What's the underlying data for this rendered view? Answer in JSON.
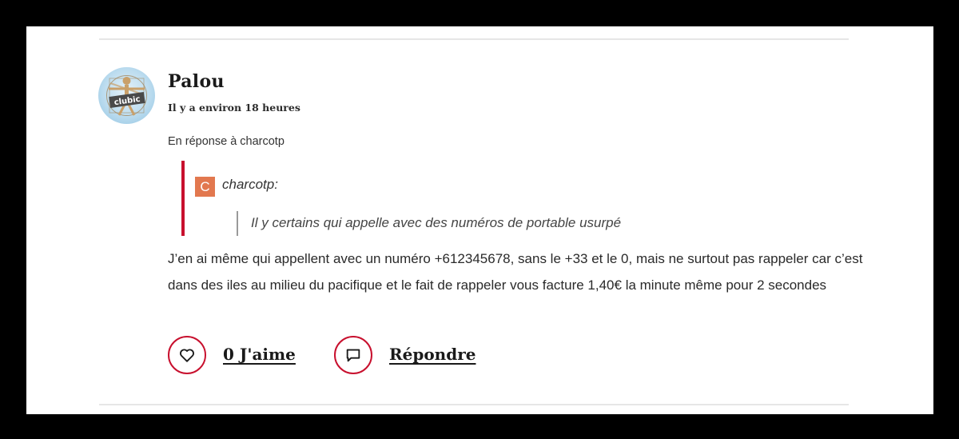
{
  "comment": {
    "author": "Palou",
    "avatar_label": "clubic",
    "timestamp": "Il y a environ 18 heures",
    "in_reply_to": "En réponse à charcotp",
    "quote": {
      "avatar_letter": "C",
      "author": "charcotp:",
      "text": "Il y certains qui appelle avec des numéros de portable usurpé"
    },
    "body": "J’en ai même qui appellent avec un numéro +612345678, sans le +33 et le 0, mais ne surtout pas rappeler car c’est dans des iles au milieu du pacifique et le fait de rappeler vous facture 1,40€ la minute même pour 2 secondes"
  },
  "actions": {
    "like_label": "0 J'aime",
    "reply_label": "Répondre"
  },
  "colors": {
    "accent": "#c8102e",
    "quote_avatar_bg": "#e2784f",
    "background": "#ffffff",
    "frame": "#000000"
  },
  "icons": {
    "like": "heart-icon",
    "reply": "speech-bubble-icon"
  }
}
